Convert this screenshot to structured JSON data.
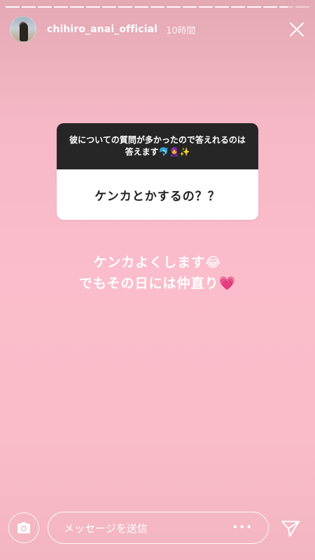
{
  "story": {
    "progress": [
      1,
      1,
      1,
      1,
      1,
      1,
      1,
      1,
      1,
      1,
      1,
      1,
      1,
      1,
      1,
      1,
      1,
      0.6,
      0
    ]
  },
  "header": {
    "username": "chihiro_anai_official",
    "timestamp": "10時間",
    "avatar_icon": "profile-photo",
    "close_icon": "close-icon"
  },
  "question_sticker": {
    "prompt": "彼についての質問が多かったので答えれるのは答えます🐬🧕✨",
    "answer": "ケンカとかするの？？"
  },
  "reply": {
    "line1": "ケンカよくします😂",
    "line2": "でもその日には仲直り💗"
  },
  "footer": {
    "camera_icon": "camera-icon",
    "message_placeholder": "メッセージを送信",
    "more_icon": "more-icon",
    "send_icon": "send-icon"
  }
}
